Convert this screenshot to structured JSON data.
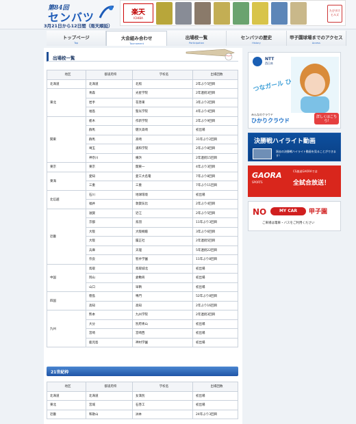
{
  "header": {
    "logo_num": "第84回",
    "logo_main": "センバツ",
    "logo_sub": "3月21日から12日間（雨天順延）"
  },
  "ad_top": {
    "logo_text": "楽天",
    "logo_sub": "ICHIBA",
    "badge": "たびすけ ヒルズ",
    "item_colors": [
      "#b8a63a",
      "#888c96",
      "#8a7a6a",
      "#c3ae54",
      "#6aa36f",
      "#d8c44a",
      "#5d86b8",
      "#c9b88a"
    ]
  },
  "nav": {
    "items": [
      {
        "jp": "トップページ",
        "en": "Top"
      },
      {
        "jp": "大会組み合わせ",
        "en": "Tournament"
      },
      {
        "jp": "出場校一覧",
        "en": "Participation"
      },
      {
        "jp": "センバツの歴史",
        "en": "History"
      },
      {
        "jp": "甲子園球場までのアクセス",
        "en": "Access"
      }
    ]
  },
  "main": {
    "title": "出場校一覧",
    "table_headers": [
      "地区",
      "都道府県",
      "学校名",
      "出場回数"
    ],
    "rows": [
      {
        "region": "北海道",
        "pref": "北海道",
        "school": "北照",
        "count": "2年ぶり5回目"
      },
      {
        "region": "東北",
        "pref": "青森",
        "school": "光星学院",
        "count": "2年連続3回目"
      },
      {
        "region": "",
        "pref": "岩手",
        "school": "花巻東",
        "count": "3年ぶり2回目"
      },
      {
        "region": "",
        "pref": "福島",
        "school": "聖光学院",
        "count": "4年ぶり4回目"
      },
      {
        "region": "関東",
        "pref": "栃木",
        "school": "作新学院",
        "count": "2年ぶり9回目"
      },
      {
        "region": "",
        "pref": "群馬",
        "school": "健大高崎",
        "count": "初出場"
      },
      {
        "region": "",
        "pref": "群馬",
        "school": "高崎",
        "count": "31年ぶり2回目"
      },
      {
        "region": "",
        "pref": "埼玉",
        "school": "浦和学院",
        "count": "2年ぶり8回目"
      },
      {
        "region": "",
        "pref": "神奈川",
        "school": "横浜",
        "count": "2年連続15回目"
      },
      {
        "region": "東京",
        "pref": "東京",
        "school": "関東一",
        "count": "4年ぶり3回目"
      },
      {
        "region": "東海",
        "pref": "愛知",
        "school": "愛工大名電",
        "count": "7年ぶり8回目"
      },
      {
        "region": "",
        "pref": "三重",
        "school": "三重",
        "count": "7年ぶり11回目"
      },
      {
        "region": "北信越",
        "pref": "石川",
        "school": "地球環境",
        "count": "初出場"
      },
      {
        "region": "",
        "pref": "福井",
        "school": "敦賀気比",
        "count": "2年ぶり4回目"
      },
      {
        "region": "近畿",
        "pref": "滋賀",
        "school": "近江",
        "count": "2年ぶり5回目"
      },
      {
        "region": "",
        "pref": "京都",
        "school": "鳥羽",
        "count": "11年ぶり3回目"
      },
      {
        "region": "",
        "pref": "大阪",
        "school": "大阪桐蔭",
        "count": "3年ぶり6回目"
      },
      {
        "region": "",
        "pref": "大阪",
        "school": "履正社",
        "count": "2年連続5回目"
      },
      {
        "region": "",
        "pref": "兵庫",
        "school": "天理",
        "count": "5年連続22回目"
      },
      {
        "region": "",
        "pref": "奈良",
        "school": "智弁学園",
        "count": "11年ぶり8回目"
      },
      {
        "region": "中国",
        "pref": "鳥取",
        "school": "鳥取城北",
        "count": "初出場"
      },
      {
        "region": "",
        "pref": "岡山",
        "school": "倉敷商",
        "count": "初出場"
      },
      {
        "region": "",
        "pref": "山口",
        "school": "早鞆",
        "count": "初出場"
      },
      {
        "region": "四国",
        "pref": "徳島",
        "school": "鳴門",
        "count": "52年ぶり8回目"
      },
      {
        "region": "",
        "pref": "高知",
        "school": "高知",
        "count": "2年ぶり16回目"
      },
      {
        "region": "九州",
        "pref": "熊本",
        "school": "九州学院",
        "count": "2年連続3回目"
      },
      {
        "region": "",
        "pref": "大分",
        "school": "別府青山",
        "count": "初出場"
      },
      {
        "region": "",
        "pref": "宮崎",
        "school": "宮崎西",
        "count": "初出場"
      },
      {
        "region": "",
        "pref": "鹿児島",
        "school": "神村学園",
        "count": "初出場"
      }
    ],
    "region_spans": {
      "北海道": 1,
      "東北": 3,
      "関東": 5,
      "東京": 1,
      "東海": 2,
      "北信越": 2,
      "近畿": 6,
      "中国": 3,
      "四国": 2,
      "九州": 4
    },
    "sub_title": "21世紀枠",
    "sub_rows": [
      {
        "region": "北海道",
        "pref": "北海道",
        "school": "女満別",
        "count": "初出場"
      },
      {
        "region": "東北",
        "pref": "宮城",
        "school": "石巻工",
        "count": "初出場"
      },
      {
        "region": "近畿",
        "pref": "和歌山",
        "school": "洲本",
        "count": "24年ぶり3回目"
      }
    ]
  },
  "sidebar": {
    "ntt": {
      "logo": "NTT",
      "sub": "西日本",
      "catch": "つなガール ひろガール",
      "small": "みんなのクラウド",
      "hikari": "ひかりクラウド",
      "btn": "詳しくはこちら!"
    },
    "final": {
      "title": "決勝戦ハイライト動画",
      "sub": "過去の決勝戦ハイライト動画を見ることができます！"
    },
    "gaora": {
      "logo": "GAORA",
      "logo_sub": "SPORTS",
      "small": "CS放送GAORAでは",
      "main": "全試合放送！"
    },
    "nomycar": {
      "no": "NO",
      "car": "MY CAR",
      "koshien": "甲子園",
      "note": "ご来場は電車・バスをご利用ください"
    }
  }
}
